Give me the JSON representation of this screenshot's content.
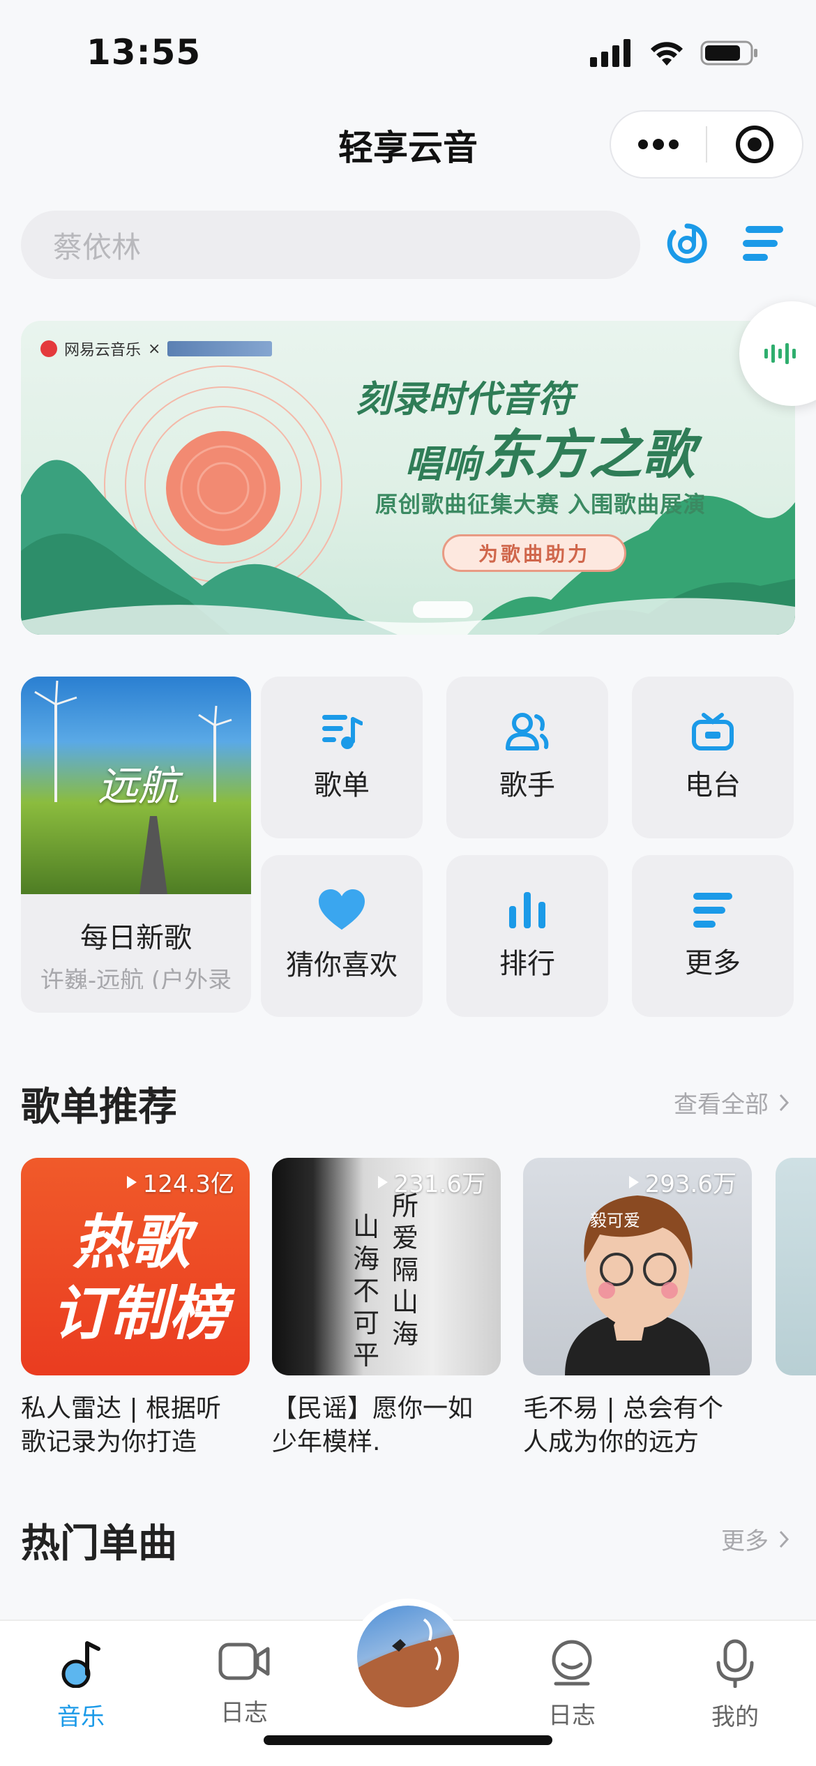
{
  "status_bar": {
    "time": "13:55"
  },
  "nav": {
    "title": "轻享云音"
  },
  "search": {
    "placeholder": "蔡依林"
  },
  "banner": {
    "logo_left": "网易云音乐",
    "logo_sep": "×",
    "line1": "刻录时代音符",
    "line2_prefix": "唱响",
    "line2_big": "东方之歌",
    "subtitle": "原创歌曲征集大赛 入围歌曲展演",
    "button": "为歌曲助力"
  },
  "daily": {
    "title": "每日新歌",
    "subtitle": "许巍-远航 (户外录",
    "cover_text": "远航"
  },
  "grid": [
    {
      "label": "歌单",
      "icon": "playlist-icon"
    },
    {
      "label": "歌手",
      "icon": "singer-icon"
    },
    {
      "label": "电台",
      "icon": "radio-icon"
    },
    {
      "label": "猜你喜欢",
      "icon": "heart-icon"
    },
    {
      "label": "排行",
      "icon": "chart-icon"
    },
    {
      "label": "更多",
      "icon": "more-icon"
    }
  ],
  "playlist_section": {
    "title": "歌单推荐",
    "more": "查看全部",
    "items": [
      {
        "count": "124.3亿",
        "cover_text_1": "热歌",
        "cover_text_2": "订制榜",
        "title_1": "私人雷达 | 根据听",
        "title_2": "歌记录为你打造"
      },
      {
        "count": "231.6万",
        "cover_text_1": "所爱隔山海",
        "cover_text_2": "山海不可平",
        "title_1": "【民谣】愿你一如",
        "title_2": "少年模样."
      },
      {
        "count": "293.6万",
        "cover_text_1": "毅可爱",
        "cover_text_2": "",
        "title_1": "毛不易 | 总会有个",
        "title_2": "人成为你的远方"
      }
    ]
  },
  "hot_section": {
    "title": "热门单曲",
    "more": "更多"
  },
  "tabs": [
    {
      "label": "音乐",
      "icon": "music-note-icon",
      "active": true
    },
    {
      "label": "日志",
      "icon": "video-icon",
      "active": false
    },
    {
      "label": "日志",
      "icon": "face-icon",
      "active": false
    },
    {
      "label": "我的",
      "icon": "microphone-icon",
      "active": false
    }
  ],
  "colors": {
    "accent": "#1b9ae8",
    "banner_sun": "#f28a72",
    "hot_red": "#f04a2a"
  }
}
